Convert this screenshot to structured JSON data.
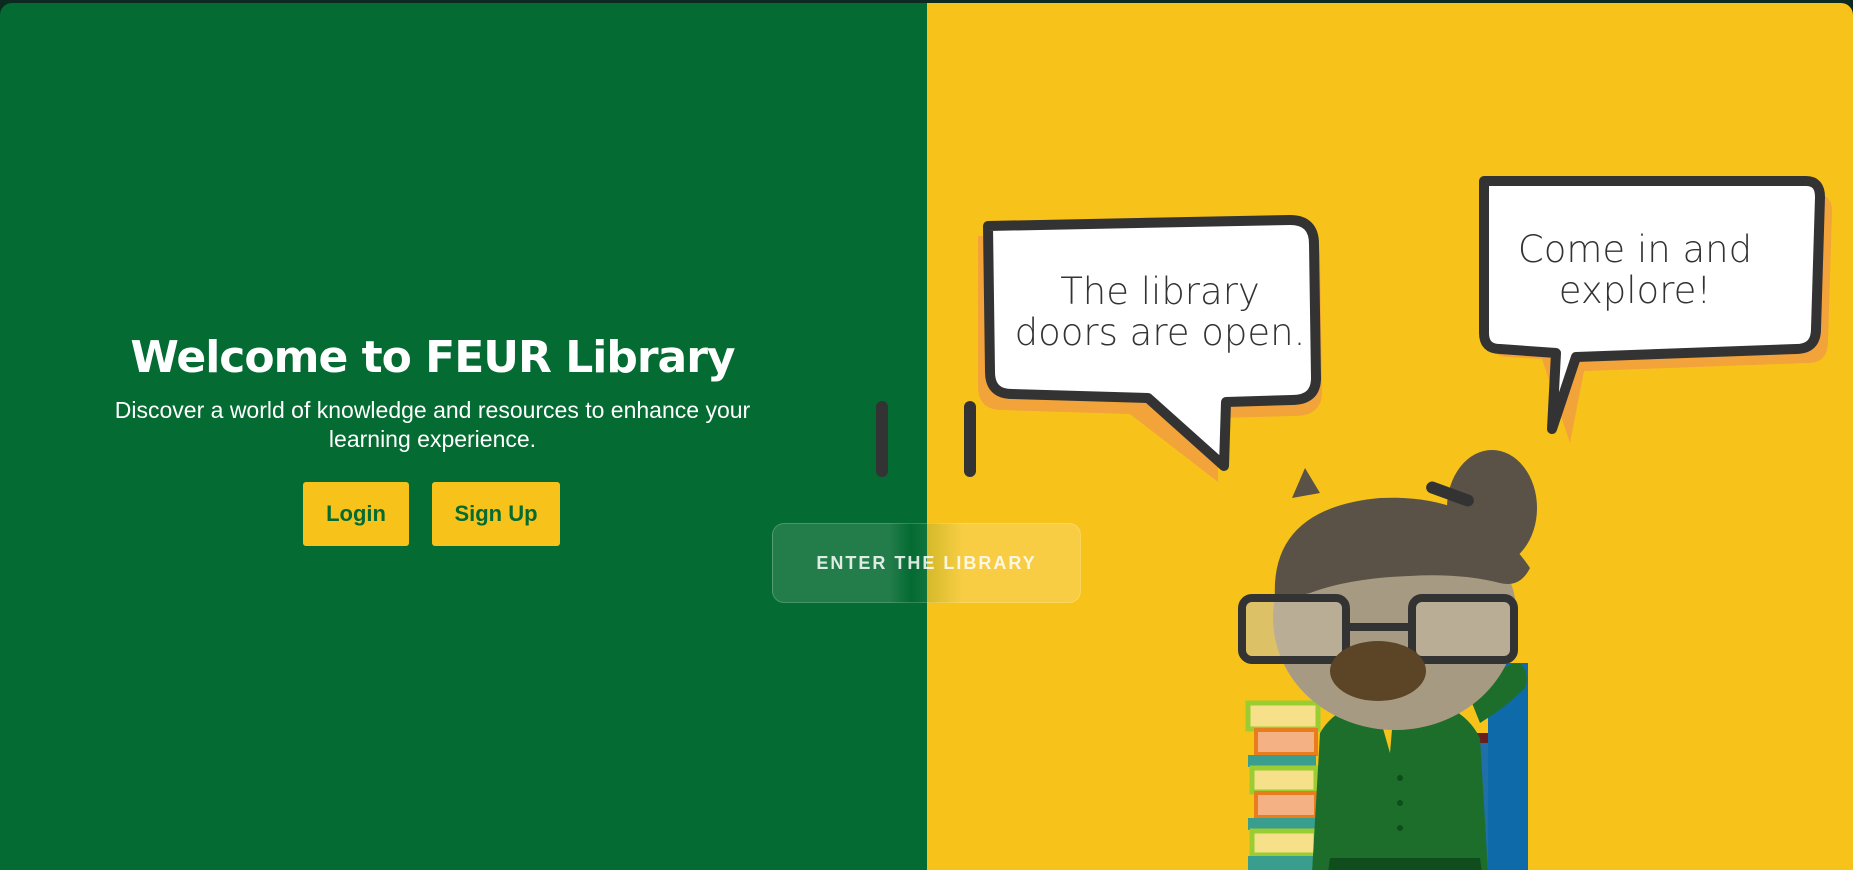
{
  "welcome": {
    "title": "Welcome to FEUR Library",
    "subtitle": "Discover a world of knowledge and resources to enhance your learning experience."
  },
  "buttons": {
    "login": "Login",
    "signup": "Sign Up",
    "enter": "ENTER THE LIBRARY"
  },
  "speech": {
    "bubble1": "The library doors are open.",
    "bubble2": "Come in and explore!"
  },
  "colors": {
    "green": "#046b32",
    "yellow": "#f7c31b",
    "bubble_shadow": "#f2a33a"
  }
}
